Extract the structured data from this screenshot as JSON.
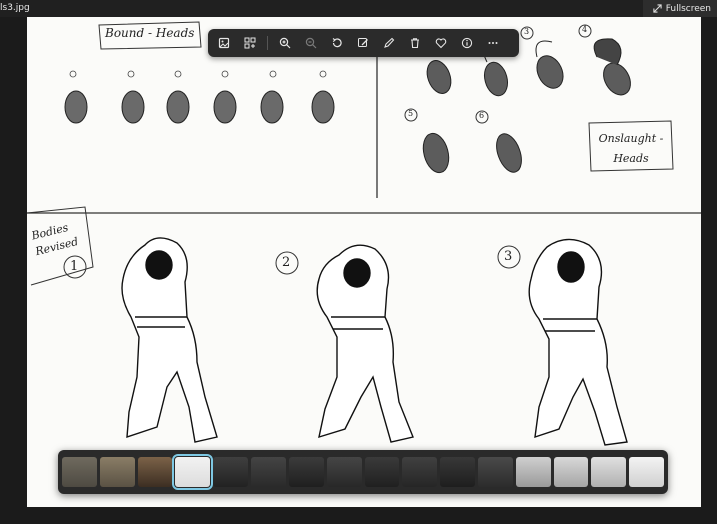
{
  "window": {
    "filename": "ls3.jpg",
    "fullscreen_label": "Fullscreen"
  },
  "sketch": {
    "bound_heads_label": "Bound - Heads",
    "onslaught_heads_label": "Onslaught - Heads",
    "bodies_label": "Bodies Revised",
    "body_numbers": [
      "1",
      "2",
      "3"
    ],
    "onslaught_numbers": [
      "3",
      "4",
      "5",
      "6"
    ]
  },
  "toolbar": {
    "buttons": [
      "crop-icon",
      "edit-image-icon",
      "zoom-in-icon",
      "zoom-out-icon",
      "rotate-icon",
      "markup-icon",
      "draw-icon",
      "delete-icon",
      "favorite-icon",
      "info-icon",
      "more-icon"
    ]
  },
  "filmstrip": {
    "thumb_count": 16,
    "active_index": 3,
    "colors": {
      "frame": "#2a2a2a",
      "active_outline": "#7ec8e3"
    }
  }
}
